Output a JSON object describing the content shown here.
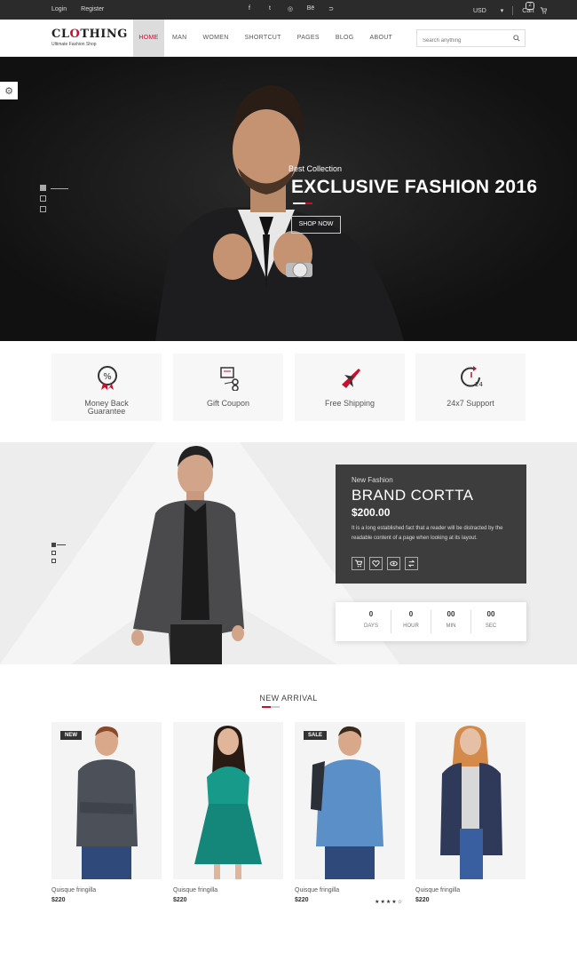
{
  "topbar": {
    "login": "Login",
    "register": "Register",
    "social": [
      "f",
      "t",
      "◎",
      "Bē",
      "⊃"
    ],
    "currency": "USD",
    "currency_caret": "▾",
    "cart_label": "Cart",
    "cart_count": "2"
  },
  "logo": {
    "name_a": "CL",
    "name_o": "O",
    "name_b": "THING",
    "tagline": "Ultimate Fashion Shop"
  },
  "nav": {
    "items": [
      "HOME",
      "MAN",
      "WOMEN",
      "SHORTCUT",
      "PAGES",
      "BLOG",
      "ABOUT"
    ]
  },
  "search": {
    "placeholder": "Search anything"
  },
  "hero": {
    "subtitle": "Best Collection",
    "title": "EXCLUSIVE FASHION 2016",
    "button": "SHOP NOW"
  },
  "services": [
    "Money Back Guarantee",
    "Gift Coupon",
    "Free Shipping",
    "24x7 Support"
  ],
  "feature": {
    "kicker": "New Fashion",
    "title": "BRAND CORTTA",
    "price": "$200.00",
    "description": "It is a long established fact that a reader will be distracted by the readable content of a page when looking at its layout.",
    "countdown": [
      {
        "value": "0",
        "unit": "DAYS"
      },
      {
        "value": "0",
        "unit": "HOUR"
      },
      {
        "value": "00",
        "unit": "MIN"
      },
      {
        "value": "00",
        "unit": "SEC"
      }
    ]
  },
  "arrivals": {
    "title": "NEW ARRIVAL",
    "products": [
      {
        "name": "Quisque fringilla",
        "price": "$220",
        "badge": "NEW"
      },
      {
        "name": "Quisque fringilla",
        "price": "$220",
        "badge": ""
      },
      {
        "name": "Quisque fringilla",
        "price": "$220",
        "badge": "SALE",
        "stars": "★★★★☆"
      },
      {
        "name": "Quisque fringilla",
        "price": "$220",
        "badge": ""
      }
    ]
  },
  "colors": {
    "accent": "#c8102e",
    "dark": "#2b2b2b",
    "card": "#3d3d3d"
  }
}
